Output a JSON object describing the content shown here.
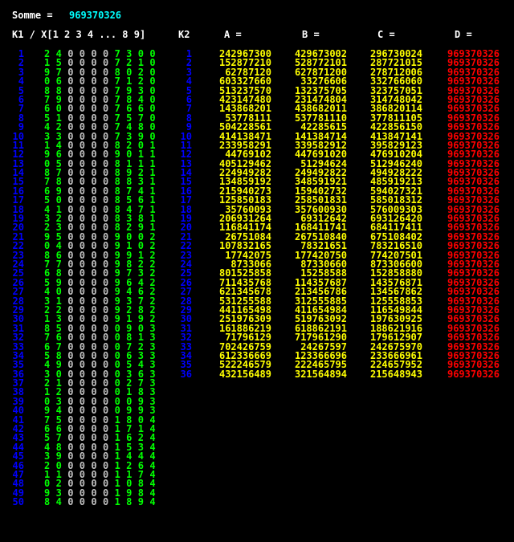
{
  "colors": {
    "background": "#000000",
    "label": "#ffffff",
    "sum": "#00ffff",
    "index": "#0000ff",
    "digit": "#00ff00",
    "zero": "#c0c0c0",
    "abc": "#ffff00",
    "d": "#ff0000"
  },
  "header": {
    "somme_label": "Somme =",
    "somme_value": "969370326",
    "k1_label": "K1 / X[1 2 3 4 ... 8 9]",
    "k2_label": "K2",
    "a_label": "A =",
    "b_label": "B =",
    "c_label": "C =",
    "d_label": "D ="
  },
  "k1_rows": [
    "2 4 0 0 0 0 7 3 0 0",
    "1 5 0 0 0 0 7 2 1 0",
    "9 7 0 0 0 0 8 0 2 0",
    "0 6 0 0 0 0 7 1 2 0",
    "8 8 0 0 0 0 7 9 3 0",
    "7 9 0 0 0 0 7 8 4 0",
    "6 0 0 0 0 0 7 6 6 0",
    "5 1 0 0 0 0 7 5 7 0",
    "4 2 0 0 0 0 7 4 8 0",
    "3 3 0 0 0 0 7 3 9 0",
    "1 4 0 0 0 0 8 2 0 1",
    "9 6 0 0 0 0 9 0 1 1",
    "0 5 0 0 0 0 8 1 1 1",
    "8 7 0 0 0 0 8 9 2 1",
    "7 8 0 0 0 0 8 8 3 1",
    "6 9 0 0 0 0 8 7 4 1",
    "5 0 0 0 0 0 8 5 6 1",
    "4 1 0 0 0 0 8 4 7 1",
    "3 2 0 0 0 0 8 3 8 1",
    "2 3 0 0 0 0 8 2 9 1",
    "9 5 0 0 0 0 9 0 0 2",
    "0 4 0 0 0 0 9 1 0 2",
    "8 6 0 0 0 0 9 9 1 2",
    "7 7 0 0 0 0 9 8 2 2",
    "6 8 0 0 0 0 9 7 3 2",
    "5 9 0 0 0 0 9 6 4 2",
    "4 0 0 0 0 0 9 4 6 2",
    "3 1 0 0 0 0 9 3 7 2",
    "2 2 0 0 0 0 9 2 8 2",
    "1 3 0 0 0 0 9 1 9 2",
    "8 5 0 0 0 0 0 9 0 3",
    "7 6 0 0 0 0 0 8 1 3",
    "6 7 0 0 0 0 0 7 2 3",
    "5 8 0 0 0 0 0 6 3 3",
    "4 9 0 0 0 0 0 5 4 3",
    "3 0 0 0 0 0 0 3 6 3",
    "2 1 0 0 0 0 0 2 7 3",
    "1 2 0 0 0 0 0 1 8 3",
    "0 3 0 0 0 0 0 0 9 3",
    "9 4 0 0 0 0 0 9 9 3",
    "7 5 0 0 0 0 1 8 0 4",
    "6 6 0 0 0 0 1 7 1 4",
    "5 7 0 0 0 0 1 6 2 4",
    "4 8 0 0 0 0 1 5 3 4",
    "3 9 0 0 0 0 1 4 4 4",
    "2 0 0 0 0 0 1 2 6 4",
    "1 1 0 0 0 0 1 1 7 4",
    "0 2 0 0 0 0 1 0 8 4",
    "9 3 0 0 0 0 1 9 8 4",
    "8 4 0 0 0 0 1 8 9 4"
  ],
  "a_values": [
    "242967300",
    "152877210",
    "62787120",
    "603327660",
    "513237570",
    "423147480",
    "143868201",
    "53778111",
    "504228561",
    "414138471",
    "233958291",
    "44769102",
    "405129462",
    "224949282",
    "134859192",
    "215940273",
    "125850183",
    "35760093",
    "206931264",
    "116841174",
    "26751084",
    "107832165",
    "17742075",
    "8733066",
    "801525858",
    "711435768",
    "621345678",
    "531255588",
    "441165498",
    "251976309",
    "161886219",
    "71796129",
    "702426759",
    "612336669",
    "522246579",
    "432156489"
  ],
  "b_values": [
    "429673002",
    "528772101",
    "627871200",
    "33276606",
    "132375705",
    "231474804",
    "438682011",
    "537781110",
    "42285615",
    "141384714",
    "339582912",
    "447691020",
    "51294624",
    "249492822",
    "348591921",
    "159402732",
    "258501831",
    "357600930",
    "69312642",
    "168411741",
    "267510840",
    "78321651",
    "177420750",
    "87330660",
    "15258588",
    "114357687",
    "213456786",
    "312555885",
    "411654984",
    "519763092",
    "618862191",
    "717961290",
    "24267597",
    "123366696",
    "222465795",
    "321564894"
  ],
  "c_values": [
    "296730024",
    "287721015",
    "278712006",
    "332766060",
    "323757051",
    "314748042",
    "386820114",
    "377811105",
    "422856150",
    "413847141",
    "395829123",
    "476910204",
    "512946240",
    "494928222",
    "485919213",
    "594027321",
    "585018312",
    "576009303",
    "693126420",
    "684117411",
    "675108402",
    "783216510",
    "774207501",
    "873306600",
    "152858880",
    "143576871",
    "134567862",
    "125558853",
    "116549844",
    "197630925",
    "188621916",
    "179612907",
    "242675970",
    "233666961",
    "224657952",
    "215648943"
  ],
  "d_values": [
    "969370326",
    "969370326",
    "969370326",
    "969370326",
    "969370326",
    "969370326",
    "969370326",
    "969370326",
    "969370326",
    "969370326",
    "969370326",
    "969370326",
    "969370326",
    "969370326",
    "969370326",
    "969370326",
    "969370326",
    "969370326",
    "969370326",
    "969370326",
    "969370326",
    "969370326",
    "969370326",
    "969370326",
    "969370326",
    "969370326",
    "969370326",
    "969370326",
    "969370326",
    "969370326",
    "969370326",
    "969370326",
    "969370326",
    "969370326",
    "969370326",
    "969370326"
  ],
  "k1_index": [
    "1",
    "2",
    "3",
    "4",
    "5",
    "6",
    "7",
    "8",
    "9",
    "10",
    "11",
    "12",
    "13",
    "14",
    "15",
    "16",
    "17",
    "18",
    "19",
    "20",
    "21",
    "22",
    "23",
    "24",
    "25",
    "26",
    "27",
    "28",
    "29",
    "30",
    "31",
    "32",
    "33",
    "34",
    "35",
    "36",
    "37",
    "38",
    "39",
    "40",
    "41",
    "42",
    "43",
    "44",
    "45",
    "46",
    "47",
    "48",
    "49",
    "50"
  ],
  "k2_index": [
    "1",
    "2",
    "3",
    "4",
    "5",
    "6",
    "7",
    "8",
    "9",
    "10",
    "11",
    "12",
    "13",
    "14",
    "15",
    "16",
    "17",
    "18",
    "19",
    "20",
    "21",
    "22",
    "23",
    "24",
    "25",
    "26",
    "27",
    "28",
    "29",
    "30",
    "31",
    "32",
    "33",
    "34",
    "35",
    "36"
  ]
}
